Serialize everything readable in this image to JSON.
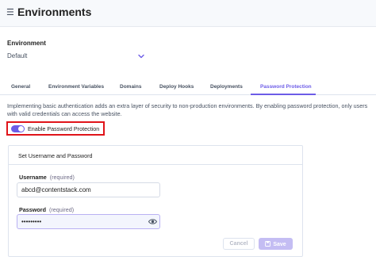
{
  "header": {
    "menu_icon": "hamburger-icon",
    "title": "Environments"
  },
  "environment": {
    "label": "Environment",
    "selected": "Default"
  },
  "tabs": [
    {
      "label": "General",
      "active": false
    },
    {
      "label": "Environment Variables",
      "active": false
    },
    {
      "label": "Domains",
      "active": false
    },
    {
      "label": "Deploy Hooks",
      "active": false
    },
    {
      "label": "Deployments",
      "active": false
    },
    {
      "label": "Password Protection",
      "active": true
    }
  ],
  "description": "Implementing basic authentication adds an extra layer of security to non-production environments. By enabling password protection, only users with valid credentials can access the website.",
  "toggle": {
    "label": "Enable Password Protection",
    "enabled": true
  },
  "card": {
    "title": "Set Username and Password",
    "username": {
      "label": "Username",
      "required_tag": "(required)",
      "value": "abcd@contentstack.com"
    },
    "password": {
      "label": "Password",
      "required_tag": "(required)",
      "value": "•••••••••"
    },
    "cancel_label": "Cancel",
    "save_label": "Save"
  },
  "colors": {
    "accent": "#6c5ce7",
    "highlight_border": "#e0141a",
    "save_disabled": "#c4bdf3"
  }
}
